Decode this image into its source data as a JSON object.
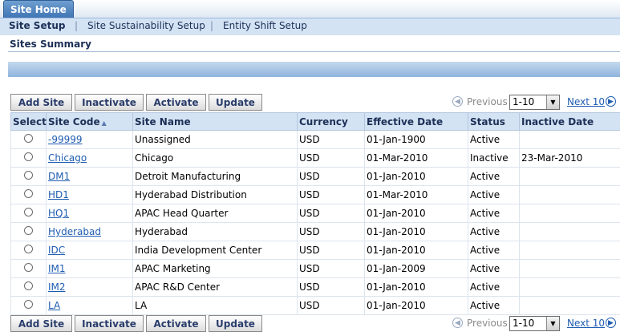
{
  "top_tab": {
    "label": "Site Home"
  },
  "subnav": {
    "items": [
      {
        "label": "Site Setup",
        "active": true
      },
      {
        "label": "Site Sustainability Setup",
        "active": false
      },
      {
        "label": "Entity Shift Setup",
        "active": false
      }
    ],
    "separator": "|"
  },
  "section_title": "Sites Summary",
  "toolbar": {
    "add_label": "Add Site",
    "inactivate_label": "Inactivate",
    "activate_label": "Activate",
    "update_label": "Update"
  },
  "pagination": {
    "previous_label": "Previous",
    "range_value": "1-10",
    "next_label": "Next 10",
    "prev_icon": "previous-icon",
    "next_icon": "next-icon"
  },
  "table": {
    "headers": {
      "select": "Select",
      "site_code": "Site Code",
      "site_name": "Site Name",
      "currency": "Currency",
      "effective_date": "Effective Date",
      "status": "Status",
      "inactive_date": "Inactive Date"
    },
    "sort_icon": "sort-ascending-icon",
    "rows": [
      {
        "code": "-99999",
        "name": "Unassigned",
        "currency": "USD",
        "effective": "01-Jan-1900",
        "status": "Active",
        "inactive": ""
      },
      {
        "code": "Chicago",
        "name": "Chicago",
        "currency": "USD",
        "effective": "01-Mar-2010",
        "status": "Inactive",
        "inactive": "23-Mar-2010"
      },
      {
        "code": "DM1",
        "name": "Detroit Manufacturing",
        "currency": "USD",
        "effective": "01-Jan-2010",
        "status": "Active",
        "inactive": ""
      },
      {
        "code": "HD1",
        "name": "Hyderabad Distribution",
        "currency": "USD",
        "effective": "01-Mar-2010",
        "status": "Active",
        "inactive": ""
      },
      {
        "code": "HQ1",
        "name": "APAC Head Quarter",
        "currency": "USD",
        "effective": "01-Jan-2010",
        "status": "Active",
        "inactive": ""
      },
      {
        "code": "Hyderabad",
        "name": "Hyderabad",
        "currency": "USD",
        "effective": "01-Jan-2010",
        "status": "Active",
        "inactive": ""
      },
      {
        "code": "IDC",
        "name": "India Development Center",
        "currency": "USD",
        "effective": "01-Jan-2010",
        "status": "Active",
        "inactive": ""
      },
      {
        "code": "IM1",
        "name": "APAC Marketing",
        "currency": "USD",
        "effective": "01-Jan-2009",
        "status": "Active",
        "inactive": ""
      },
      {
        "code": "IM2",
        "name": "APAC R&D Center",
        "currency": "USD",
        "effective": "01-Jan-2010",
        "status": "Active",
        "inactive": ""
      },
      {
        "code": "LA",
        "name": "LA",
        "currency": "USD",
        "effective": "01-Jan-2010",
        "status": "Active",
        "inactive": ""
      }
    ]
  }
}
